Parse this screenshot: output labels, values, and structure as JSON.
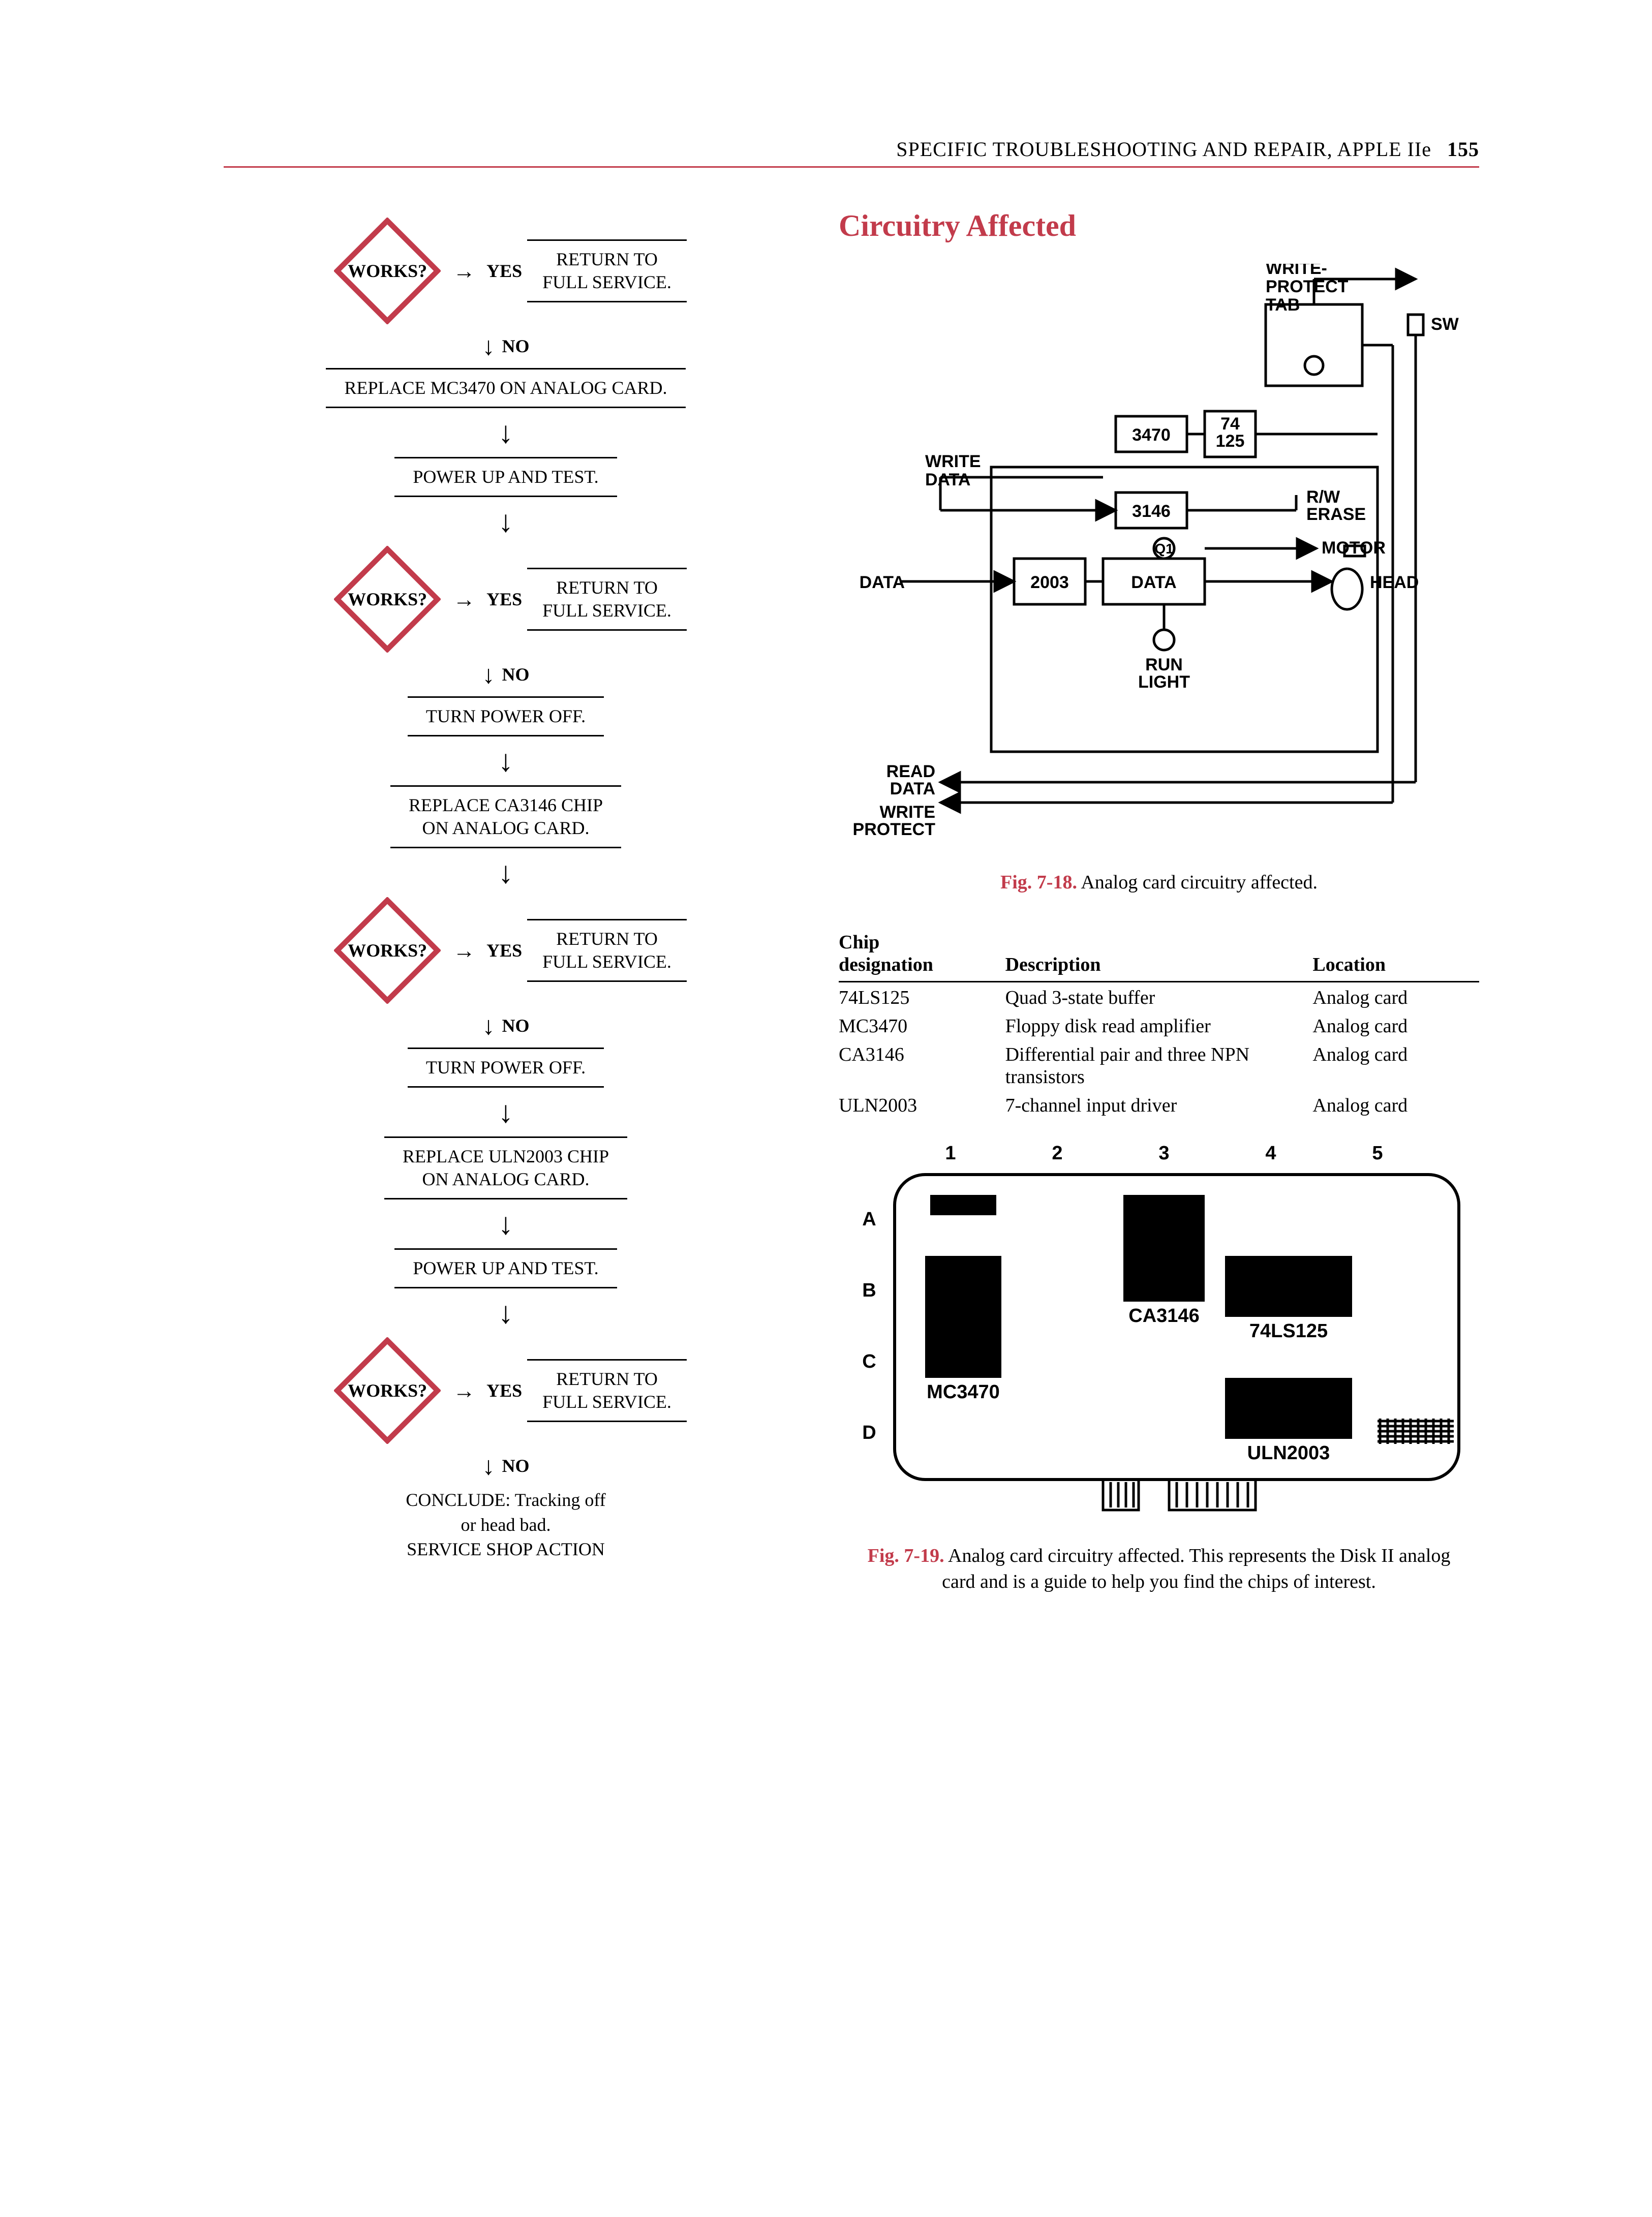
{
  "header": {
    "running_head": "SPECIFIC TROUBLESHOOTING AND REPAIR, APPLE IIe",
    "page_number": "155"
  },
  "section_heading": "Circuitry Affected",
  "flowchart": {
    "decision_label": "WORKS?",
    "yes_label": "YES",
    "no_label": "NO",
    "return_line1": "RETURN TO",
    "return_line2": "FULL SERVICE.",
    "steps": {
      "s1": "REPLACE MC3470 ON ANALOG CARD.",
      "s2": "POWER UP AND TEST.",
      "s3": "TURN POWER OFF.",
      "s4_line1": "REPLACE CA3146 CHIP",
      "s4_line2": "ON ANALOG CARD.",
      "s5": "TURN POWER OFF.",
      "s6_line1": "REPLACE ULN2003 CHIP",
      "s6_line2": "ON ANALOG CARD.",
      "s7": "POWER UP AND TEST.",
      "final_line1": "CONCLUDE: Tracking off",
      "final_line2": "or head bad.",
      "final_line3": "SERVICE SHOP ACTION"
    }
  },
  "fig18": {
    "labels": {
      "write_protect_tab": "WRITE-\nPROTECT\nTAB",
      "sw": "SW",
      "write_data": "WRITE\nDATA",
      "data_left": "DATA",
      "box_2003": "2003",
      "box_data": "DATA",
      "box_3470": "3470",
      "box_74125": "74\n125",
      "box_3146": "3146",
      "rw_erase": "R/W\nERASE",
      "motor": "MOTOR",
      "head": "HEAD",
      "q1": "Q1",
      "run_light": "RUN\nLIGHT",
      "read_data": "READ\nDATA",
      "write_protect": "WRITE\nPROTECT"
    },
    "caption_num": "Fig. 7-18.",
    "caption_text": "Analog card circuitry affected."
  },
  "chip_table": {
    "headers": {
      "c1_line1": "Chip",
      "c1_line2": "designation",
      "c2": "Description",
      "c3": "Location"
    },
    "rows": [
      {
        "chip": "74LS125",
        "desc": "Quad 3-state buffer",
        "loc": "Analog card"
      },
      {
        "chip": "MC3470",
        "desc": "Floppy disk read amplifier",
        "loc": "Analog card"
      },
      {
        "chip": "CA3146",
        "desc": "Differential pair and three NPN transistors",
        "loc": "Analog card"
      },
      {
        "chip": "ULN2003",
        "desc": "7-channel input driver",
        "loc": "Analog card"
      }
    ]
  },
  "fig19": {
    "cols": [
      "1",
      "2",
      "3",
      "4",
      "5"
    ],
    "rows": [
      "A",
      "B",
      "C",
      "D"
    ],
    "labels": {
      "mc3470": "MC3470",
      "ca3146": "CA3146",
      "ls125": "74LS125",
      "uln2003": "ULN2003"
    },
    "caption_num": "Fig. 7-19.",
    "caption_text": "Analog card circuitry affected. This represents the Disk II analog card and is a guide to help you find the chips of interest."
  }
}
